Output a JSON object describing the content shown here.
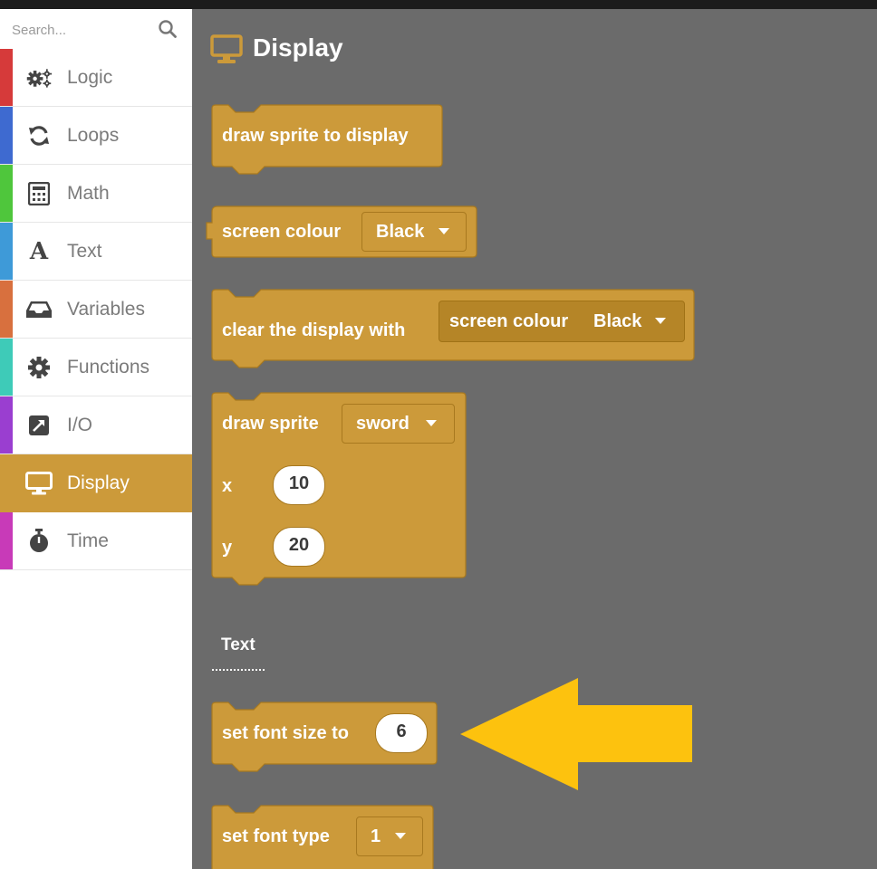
{
  "search": {
    "placeholder": "Search..."
  },
  "categories": [
    {
      "label": "Logic",
      "icon": "gears-icon",
      "color": "#d63a3a"
    },
    {
      "label": "Loops",
      "icon": "refresh-icon",
      "color": "#3e6ad0"
    },
    {
      "label": "Math",
      "icon": "calculator-icon",
      "color": "#4fc63c"
    },
    {
      "label": "Text",
      "icon": "text-a-icon",
      "color": "#3e9ad8"
    },
    {
      "label": "Variables",
      "icon": "inbox-tray-icon",
      "color": "#d8703e"
    },
    {
      "label": "Functions",
      "icon": "gear-icon",
      "color": "#3ecbb8"
    },
    {
      "label": "I/O",
      "icon": "arrow-out-icon",
      "color": "#9a3ed0"
    },
    {
      "label": "Display",
      "icon": "monitor-icon",
      "color": "#cc9a3a",
      "active": true
    },
    {
      "label": "Time",
      "icon": "stopwatch-icon",
      "color": "#c83ab8"
    }
  ],
  "flyout": {
    "title": "Display",
    "blocks": {
      "draw_sprite_to_display": {
        "label": "draw sprite to display"
      },
      "screen_colour": {
        "label": "screen colour",
        "value": "Black"
      },
      "clear_display": {
        "label": "clear the display with",
        "inner_label": "screen colour",
        "inner_value": "Black"
      },
      "draw_sprite": {
        "label": "draw sprite",
        "sprite": "sword",
        "x_label": "x",
        "x": "10",
        "y_label": "y",
        "y": "20"
      },
      "set_font_size": {
        "label": "set font size to",
        "value": "6"
      },
      "set_font_type": {
        "label": "set font type",
        "value": "1"
      }
    },
    "section_text_label": "Text"
  },
  "colors": {
    "block": "#cc9a3a",
    "block_border": "#a8791f",
    "workspace": "#6b6b6b",
    "arrow": "#fdc20e"
  }
}
